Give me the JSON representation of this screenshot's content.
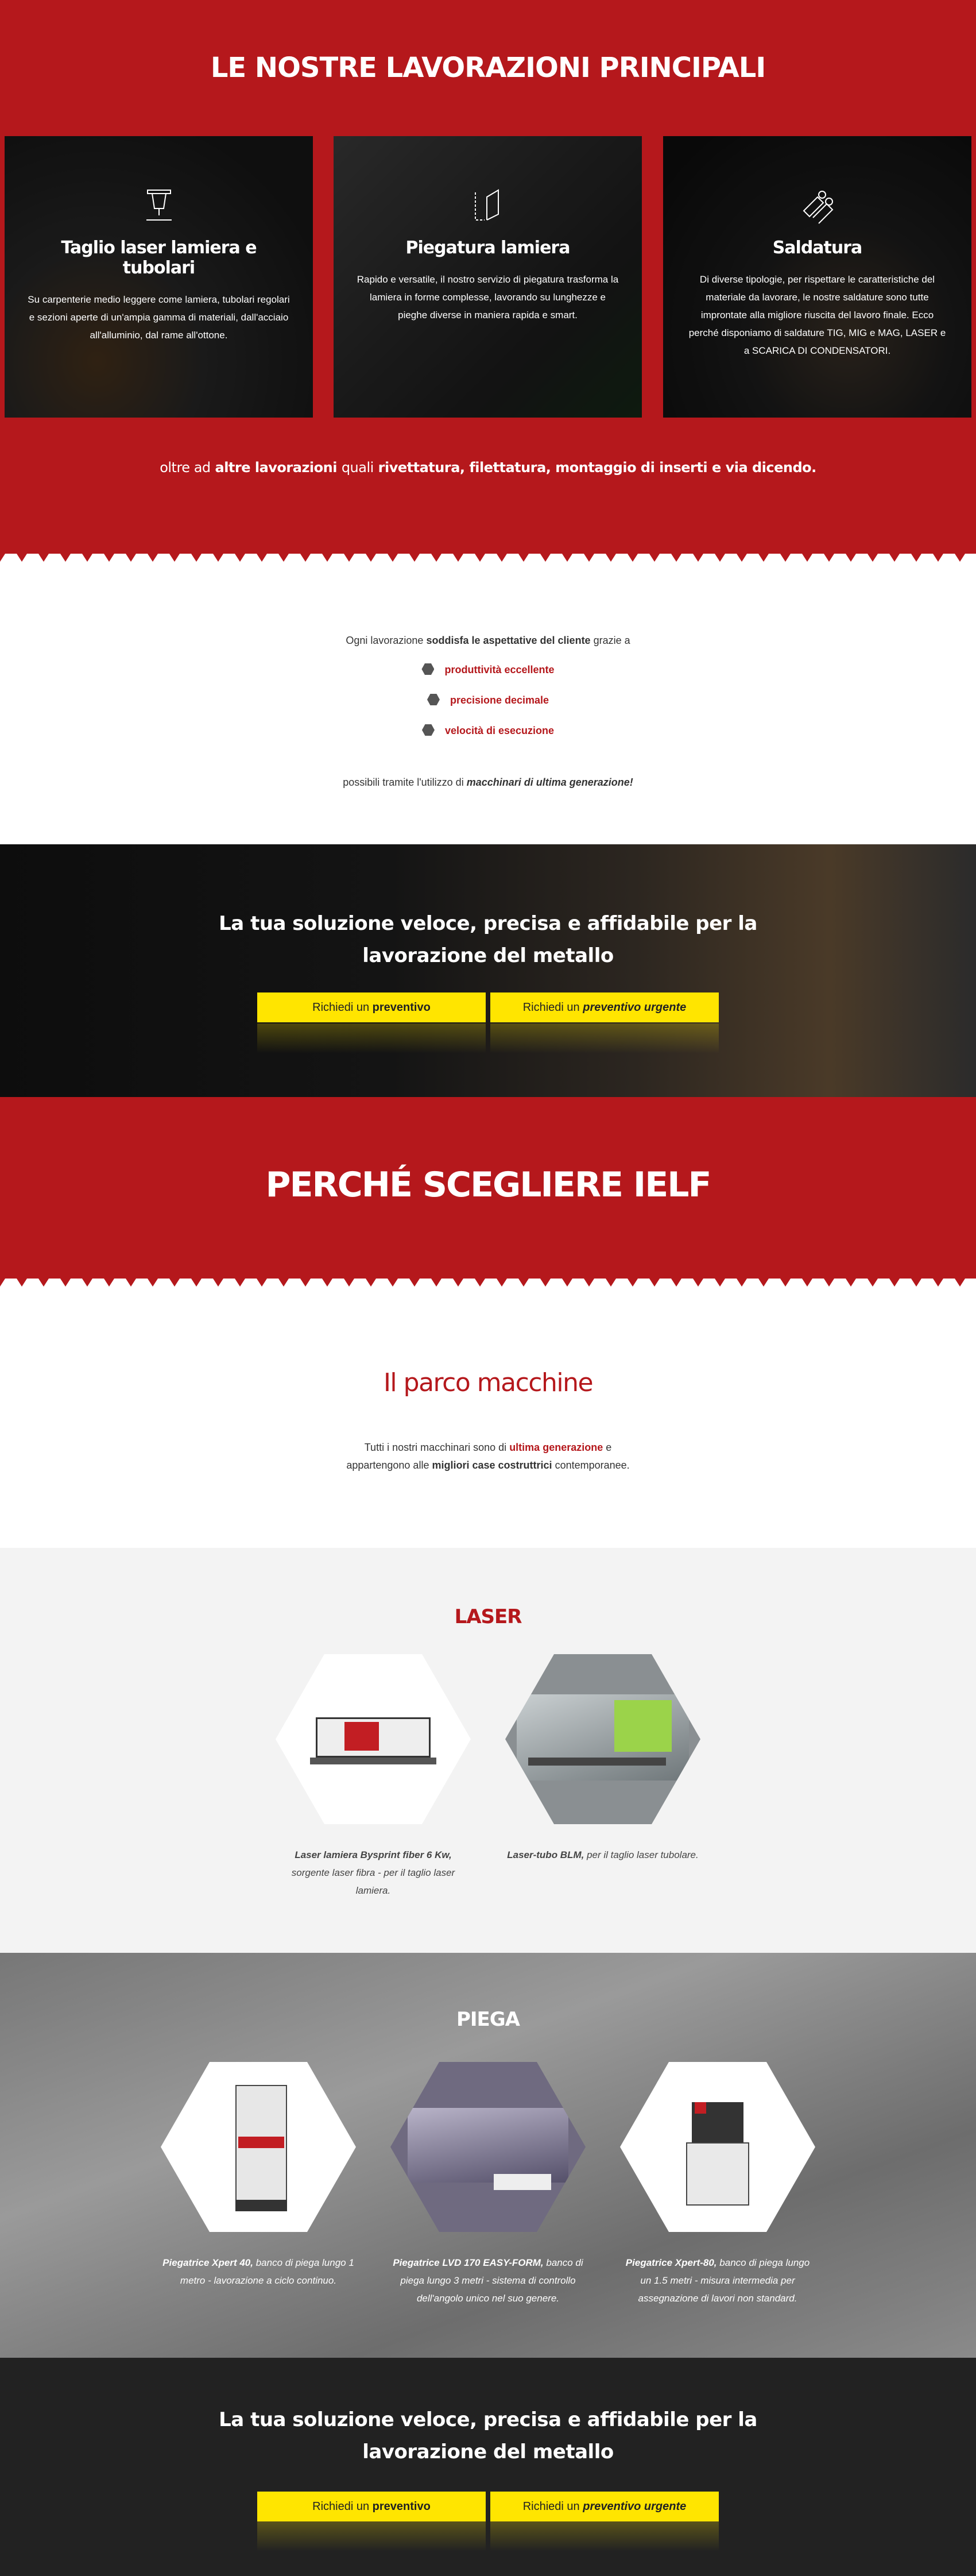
{
  "lavorazioni": {
    "title": "LE NOSTRE LAVORAZIONI PRINCIPALI",
    "cards": [
      {
        "title": "Taglio laser lamiera e tubolari",
        "text": "Su carpenterie medio leggere come lamiera, tubolari regolari e sezioni aperte di un'ampia gamma di materiali, dall'acciaio all'alluminio, dal rame all'ottone.",
        "icon": "laser-cut-icon"
      },
      {
        "title": "Piegatura lamiera",
        "text": "Rapido e versatile, il nostro servizio di piegatura trasforma la lamiera in forme complesse, lavorando su lunghezze e pieghe diverse in maniera rapida e smart.",
        "icon": "bending-icon"
      },
      {
        "title": "Saldatura",
        "text": "Di diverse tipologie, per rispettare le caratteristiche del materiale da lavorare, le nostre saldature sono tutte improntate alla migliore riuscita del lavoro finale. Ecco perché disponiamo di saldature TIG, MIG e MAG, LASER e a SCARICA DI CONDENSATORI.",
        "icon": "welding-icon"
      }
    ],
    "extra_pre": "oltre ad",
    "extra_bold": "altre lavorazioni",
    "extra_mid": "quali",
    "extra_list": "rivettatura, filettatura, montaggio di inserti e via dicendo."
  },
  "qualita": {
    "intro_pre": "Ogni lavorazione",
    "intro_bold": "soddisfa le aspettative del cliente",
    "intro_post": "grazie a",
    "items": [
      "produttività eccellente",
      "precisione decimale",
      "velocità di esecuzione"
    ],
    "outro_pre": "possibili tramite l'utilizzo di",
    "outro_bold": "macchinari di ultima generazione!"
  },
  "cta": {
    "title_line1": "La tua soluzione veloce, precisa e affidabile per la",
    "title_line2": "lavorazione del metallo",
    "btn1_pre": "Richiedi un",
    "btn1_bold": "preventivo",
    "btn2_pre": "Richiedi un",
    "btn2_bold": "preventivo urgente"
  },
  "perche": {
    "title": "PERCHÉ SCEGLIERE IELF"
  },
  "parco": {
    "title": "Il parco macchine",
    "line1_pre": "Tutti i nostri macchinari sono di",
    "line1_red": "ultima generazione",
    "line1_post": "e",
    "line2_pre": "appartengono alle",
    "line2_bold": "migliori case costruttrici",
    "line2_post": "contemporanee."
  },
  "laser": {
    "title": "LASER",
    "items": [
      {
        "name": "Laser lamiera Bysprint fiber 6 Kw,",
        "desc": "sorgente laser fibra - per il taglio laser lamiera."
      },
      {
        "name": "Laser-tubo BLM,",
        "desc": "per il taglio laser tubolare."
      }
    ]
  },
  "piega": {
    "title": "PIEGA",
    "items": [
      {
        "name": "Piegatrice Xpert 40,",
        "desc": "banco di piega lungo 1 metro - lavorazione a ciclo continuo."
      },
      {
        "name": "Piegatrice LVD 170 EASY-FORM,",
        "desc": "banco di piega lungo 3 metri - sistema di controllo dell'angolo unico nel suo genere."
      },
      {
        "name": "Piegatrice Xpert-80,",
        "desc": "banco di piega lungo un 1.5 metri - misura intermedia per assegnazione di lavori non standard."
      }
    ]
  },
  "colors": {
    "brand_red": "#b5181c",
    "cta_yellow": "#ffe500"
  }
}
